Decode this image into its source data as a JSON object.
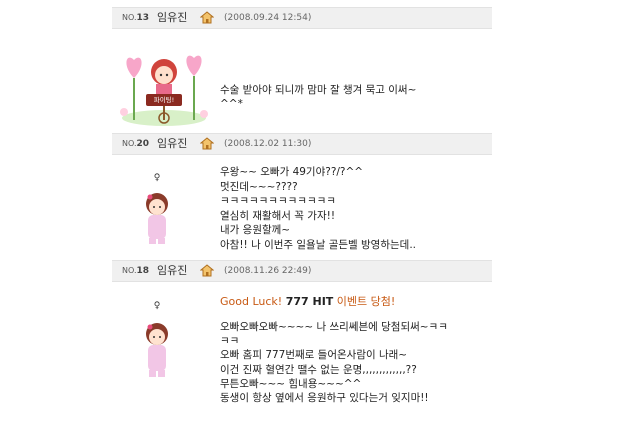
{
  "entries": [
    {
      "no_prefix": "NO.",
      "no": "13",
      "name": "임유진",
      "date": "(2008.09.24 12:54)",
      "message": "수술 받아야 되니까 맘마 잘 챙겨 묵고 이써~\n^^*",
      "minimi_sign": "파이팅!"
    },
    {
      "no_prefix": "NO.",
      "no": "20",
      "name": "임유진",
      "date": "(2008.12.02 11:30)",
      "message": "우왕~~ 오빠가 49기야??/?^^\n멋진데~~~????\nㅋㅋㅋㅋㅋㅋㅋㅋㅋㅋㅋㅋ\n열심히 재활해서 꼭 가자!!\n내가 응원할께~\n아참!! 나 이번주 일욜날 골든벨 방영하는데.."
    },
    {
      "no_prefix": "NO.",
      "no": "18",
      "name": "임유진",
      "date": "(2008.11.26 22:49)",
      "event": {
        "prefix": "Good Luck!",
        "hit": "777 HIT",
        "suffix": "이벤트 당첨!"
      },
      "message": "오빠오빠오빠~~~~ 나 쓰리쎄븐에 당첨되써~ㅋㅋ\nㅋㅋ\n오빠 홈피 777번째로 들어온사람이 나래~\n이건 진짜 혈연간 땔수 없는 운명,,,,,,,,,,,,,??\n무튼오빠~~~ 힘내용~~~^^\n동생이 항상 옆에서 응원하구 있다는거 잊지마!!"
    }
  ],
  "colors": {
    "header_bg": "#f0f0f0",
    "event_orange": "#c85a14",
    "home_icon": "#e0a040"
  }
}
